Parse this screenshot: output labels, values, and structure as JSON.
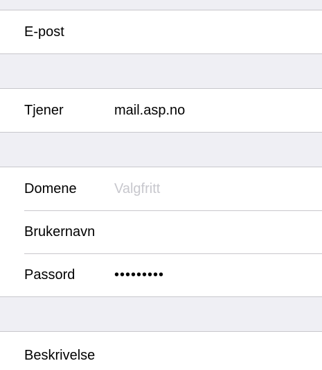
{
  "account_type_group": {
    "email_label": "E-post"
  },
  "server_group": {
    "server_label": "Tjener",
    "server_value": "mail.asp.no"
  },
  "credentials_group": {
    "domain_label": "Domene",
    "domain_value": "",
    "domain_placeholder": "Valgfritt",
    "username_label": "Brukernavn",
    "username_value": "",
    "password_label": "Passord",
    "password_value": "•••••••••"
  },
  "description_group": {
    "description_label": "Beskrivelse"
  },
  "colors": {
    "background": "#efeff4",
    "cell": "#ffffff",
    "separator": "#c8c7cc",
    "placeholder": "#c7c7cd",
    "text": "#000000"
  }
}
